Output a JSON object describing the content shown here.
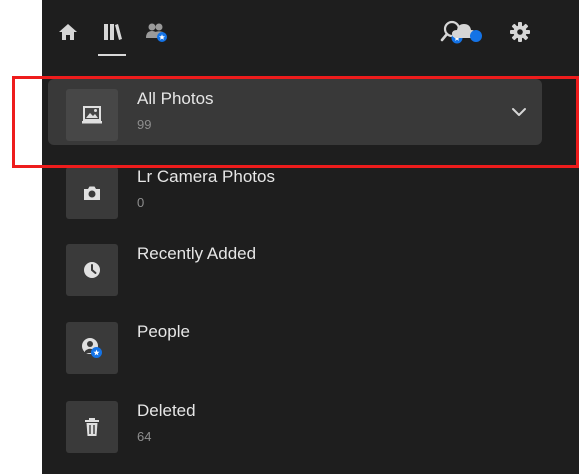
{
  "topbar": {
    "icons": [
      "home-icon",
      "library-icon",
      "shared-people-icon",
      "search-people-icon",
      "cloud-sync-icon",
      "gear-icon"
    ]
  },
  "albums": [
    {
      "label": "All Photos",
      "count": "99",
      "icon": "photo-icon",
      "selected": true
    },
    {
      "label": "Lr Camera Photos",
      "count": "0",
      "icon": "camera-icon",
      "selected": false
    },
    {
      "label": "Recently Added",
      "count": "",
      "icon": "clock-icon",
      "selected": false
    },
    {
      "label": "People",
      "count": "",
      "icon": "person-icon",
      "selected": false
    },
    {
      "label": "Deleted",
      "count": "64",
      "icon": "trash-icon",
      "selected": false
    }
  ],
  "colors": {
    "panel_bg": "#1e1e1e",
    "selected_row_bg": "#393939",
    "badge_blue": "#1473e6",
    "annotation_red": "#ee1c1c"
  }
}
